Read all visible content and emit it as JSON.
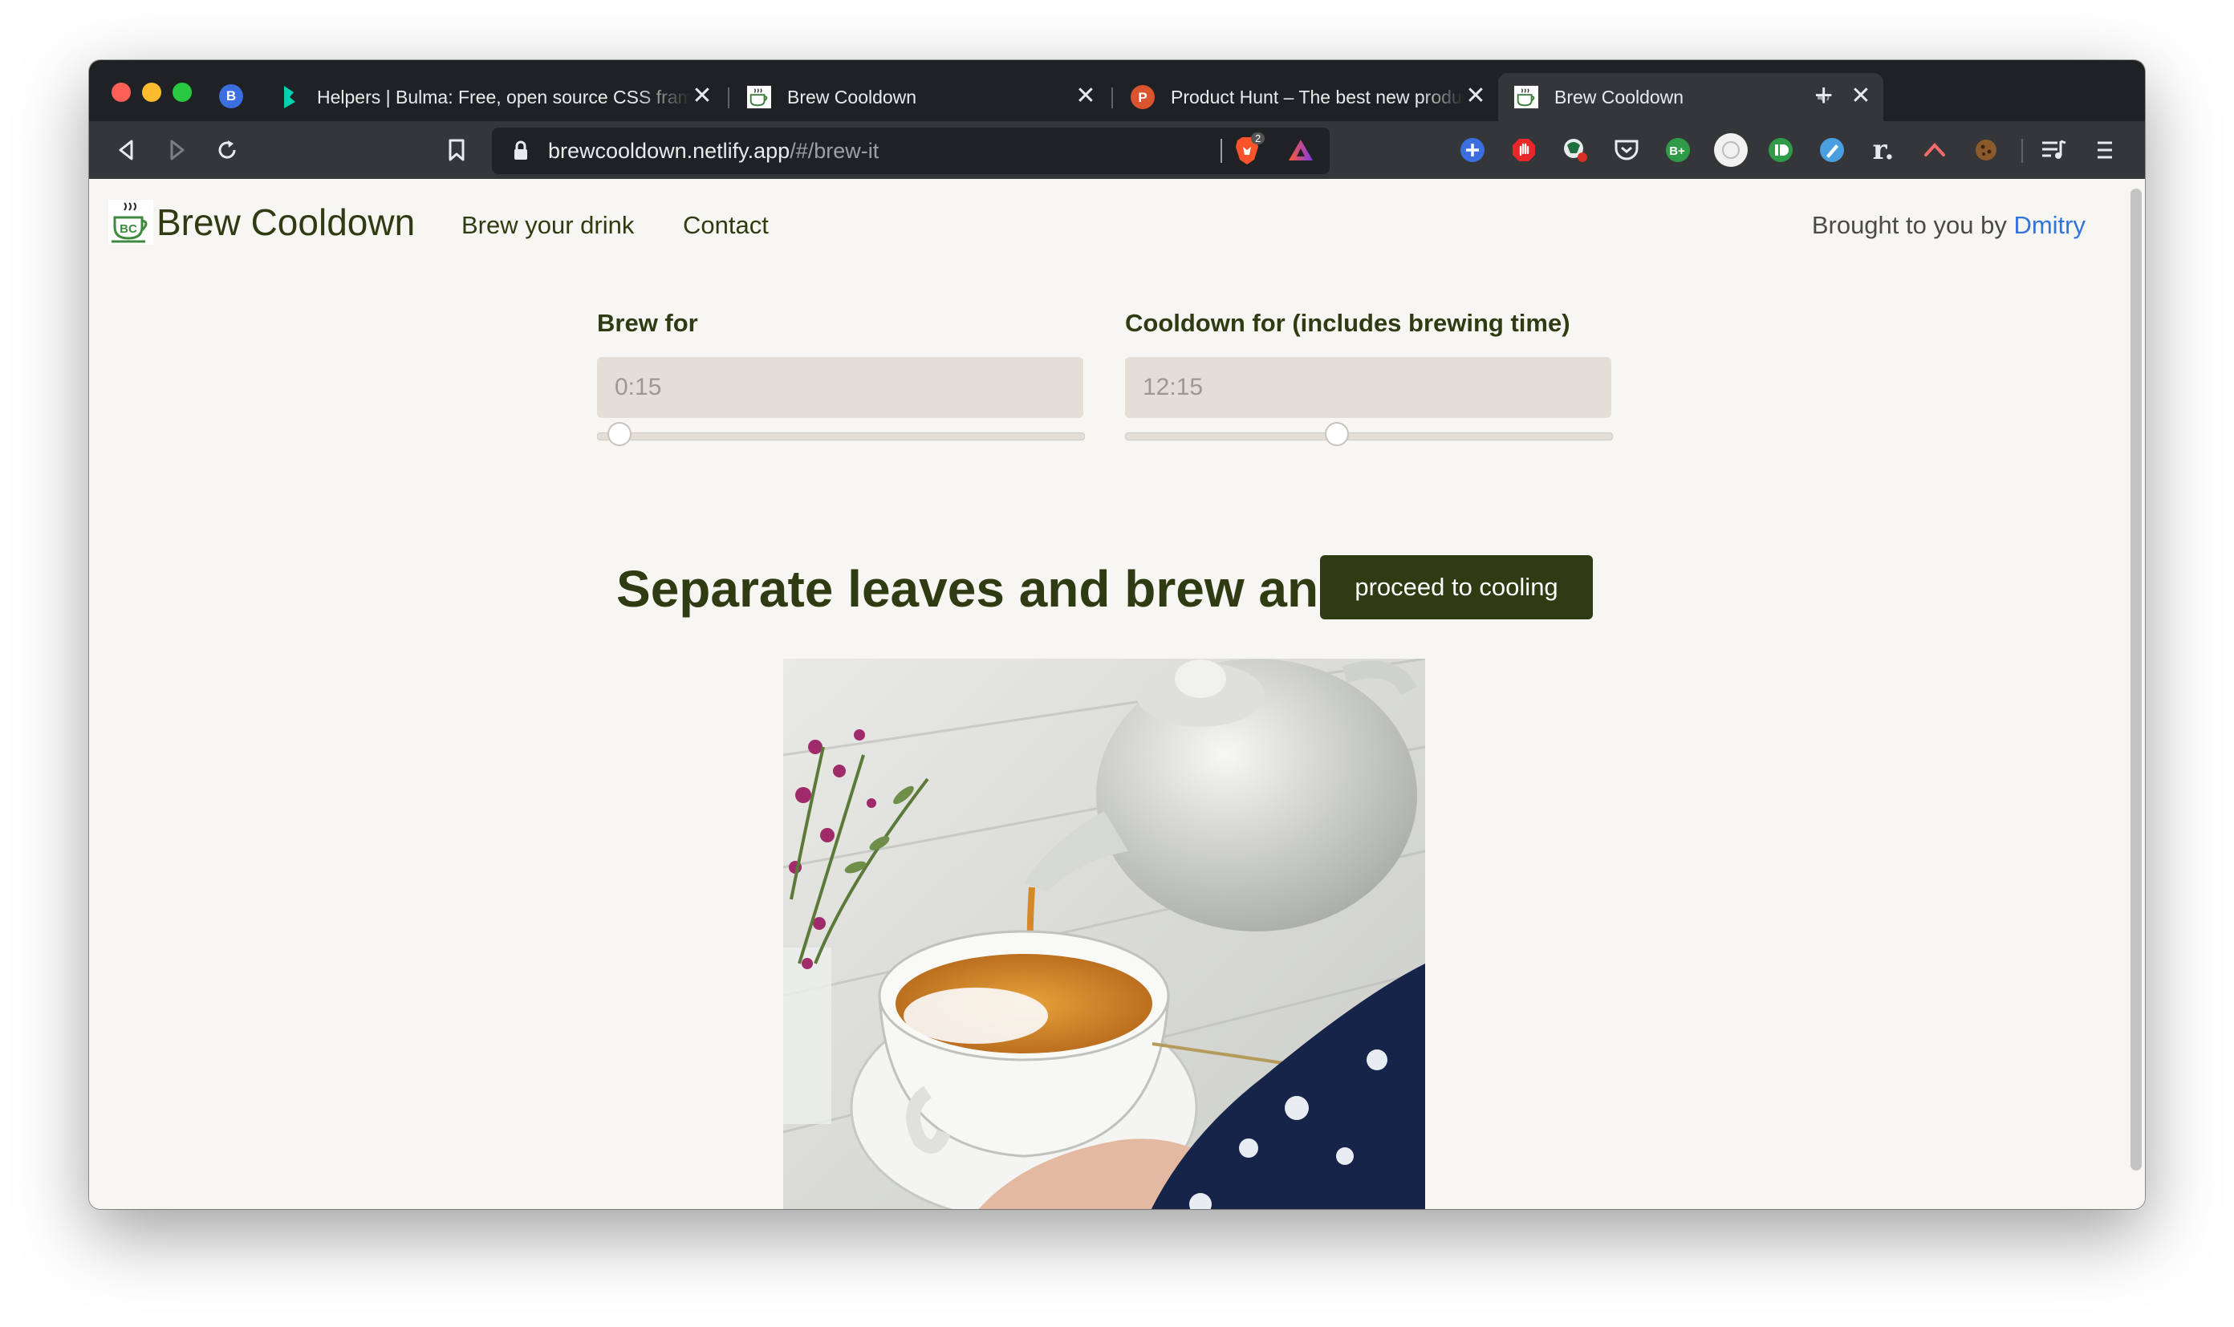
{
  "browser": {
    "profile_initial": "B",
    "tabs": [
      {
        "title": "Helpers | Bulma: Free, open source CSS framework",
        "close": "✕"
      },
      {
        "title": "Brew Cooldown",
        "close": "✕"
      },
      {
        "title": "Product Hunt – The best new products in tech",
        "close": "✕"
      },
      {
        "title": "Brew Cooldown",
        "close": "✕"
      }
    ],
    "new_tab": "+",
    "url_host": "brewcooldown.netlify.app",
    "url_path": "/#/brew-it",
    "brave_shield_count": "2",
    "ext_r": "r."
  },
  "site": {
    "brand": "Brew Cooldown",
    "logo_text": "BC",
    "nav": [
      "Brew your drink",
      "Contact"
    ],
    "byline_prefix": "Brought to you by",
    "byline_author": "Dmitry"
  },
  "form": {
    "brew_label": "Brew for",
    "brew_value": "0:15",
    "brew_slider_fraction": 0.02,
    "cooldown_label": "Cooldown for (includes brewing time)",
    "cooldown_value": "12:15",
    "cooldown_slider_fraction": 0.43
  },
  "main": {
    "headline": "Separate leaves and brew and",
    "cta": "proceed to cooling"
  },
  "colors": {
    "brand_green": "#2f3b12",
    "link_blue": "#3273dc",
    "page_bg": "#f8f6f2",
    "input_bg": "#e3ded8"
  }
}
